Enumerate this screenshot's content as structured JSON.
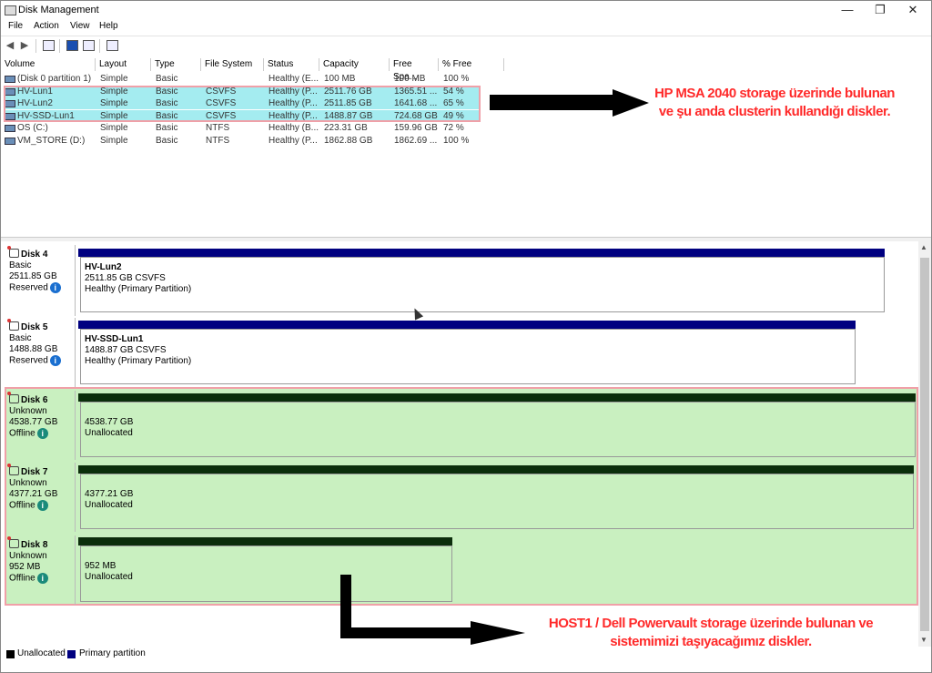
{
  "window": {
    "title": "Disk Management"
  },
  "menu": [
    "File",
    "Action",
    "View",
    "Help"
  ],
  "columns": [
    "Volume",
    "Layout",
    "Type",
    "File System",
    "Status",
    "Capacity",
    "Free Spa...",
    "% Free"
  ],
  "volumes": [
    {
      "volume": "(Disk 0 partition 1)",
      "layout": "Simple",
      "type": "Basic",
      "fs": "",
      "status": "Healthy (E...",
      "capacity": "100 MB",
      "free": "100 MB",
      "pct": "100 %",
      "selected": false
    },
    {
      "volume": "HV-Lun1",
      "layout": "Simple",
      "type": "Basic",
      "fs": "CSVFS",
      "status": "Healthy (P...",
      "capacity": "2511.76 GB",
      "free": "1365.51 ...",
      "pct": "54 %",
      "selected": true
    },
    {
      "volume": "HV-Lun2",
      "layout": "Simple",
      "type": "Basic",
      "fs": "CSVFS",
      "status": "Healthy (P...",
      "capacity": "2511.85 GB",
      "free": "1641.68 ...",
      "pct": "65 %",
      "selected": true
    },
    {
      "volume": "HV-SSD-Lun1",
      "layout": "Simple",
      "type": "Basic",
      "fs": "CSVFS",
      "status": "Healthy (P...",
      "capacity": "1488.87 GB",
      "free": "724.68 GB",
      "pct": "49 %",
      "selected": true
    },
    {
      "volume": "OS (C:)",
      "layout": "Simple",
      "type": "Basic",
      "fs": "NTFS",
      "status": "Healthy (B...",
      "capacity": "223.31 GB",
      "free": "159.96 GB",
      "pct": "72 %",
      "selected": false
    },
    {
      "volume": "VM_STORE (D:)",
      "layout": "Simple",
      "type": "Basic",
      "fs": "NTFS",
      "status": "Healthy (P...",
      "capacity": "1862.88 GB",
      "free": "1862.69 ...",
      "pct": "100 %",
      "selected": false
    }
  ],
  "annotation_top": {
    "line1": "HP MSA 2040 storage üzerinde bulunan",
    "line2": "ve şu anda clusterin kullandığı diskler."
  },
  "annotation_bottom": {
    "line1": "HOST1 / Dell Powervault storage üzerinde bulunan ve",
    "line2": "sistemimizi taşıyacağımız diskler."
  },
  "disks": [
    {
      "name": "Disk 4",
      "kind": "Basic",
      "size": "2511.85 GB",
      "state": "Reserved",
      "part_name": "HV-Lun2",
      "part_size": "2511.85 GB CSVFS",
      "part_status": "Healthy (Primary Partition)"
    },
    {
      "name": "Disk 5",
      "kind": "Basic",
      "size": "1488.88 GB",
      "state": "Reserved",
      "part_name": "HV-SSD-Lun1",
      "part_size": "1488.87 GB CSVFS",
      "part_status": "Healthy (Primary Partition)"
    },
    {
      "name": "Disk 6",
      "kind": "Unknown",
      "size": "4538.77 GB",
      "state": "Offline",
      "part_name": "",
      "part_size": "4538.77 GB",
      "part_status": "Unallocated"
    },
    {
      "name": "Disk 7",
      "kind": "Unknown",
      "size": "4377.21 GB",
      "state": "Offline",
      "part_name": "",
      "part_size": "4377.21 GB",
      "part_status": "Unallocated"
    },
    {
      "name": "Disk 8",
      "kind": "Unknown",
      "size": "952 MB",
      "state": "Offline",
      "part_name": "",
      "part_size": "952 MB",
      "part_status": "Unallocated"
    }
  ],
  "legend": {
    "unallocated": "Unallocated",
    "primary": "Primary partition"
  },
  "colors": {
    "primary_bar": "#000080",
    "unallocated_bar": "#0b2e0b",
    "selection": "#a4ecf0",
    "highlight_green": "#c9f0c0",
    "annotation": "#ff2a2a"
  },
  "icons": {
    "back": "arrow-left-icon",
    "forward": "arrow-right-icon",
    "help": "help-icon"
  }
}
